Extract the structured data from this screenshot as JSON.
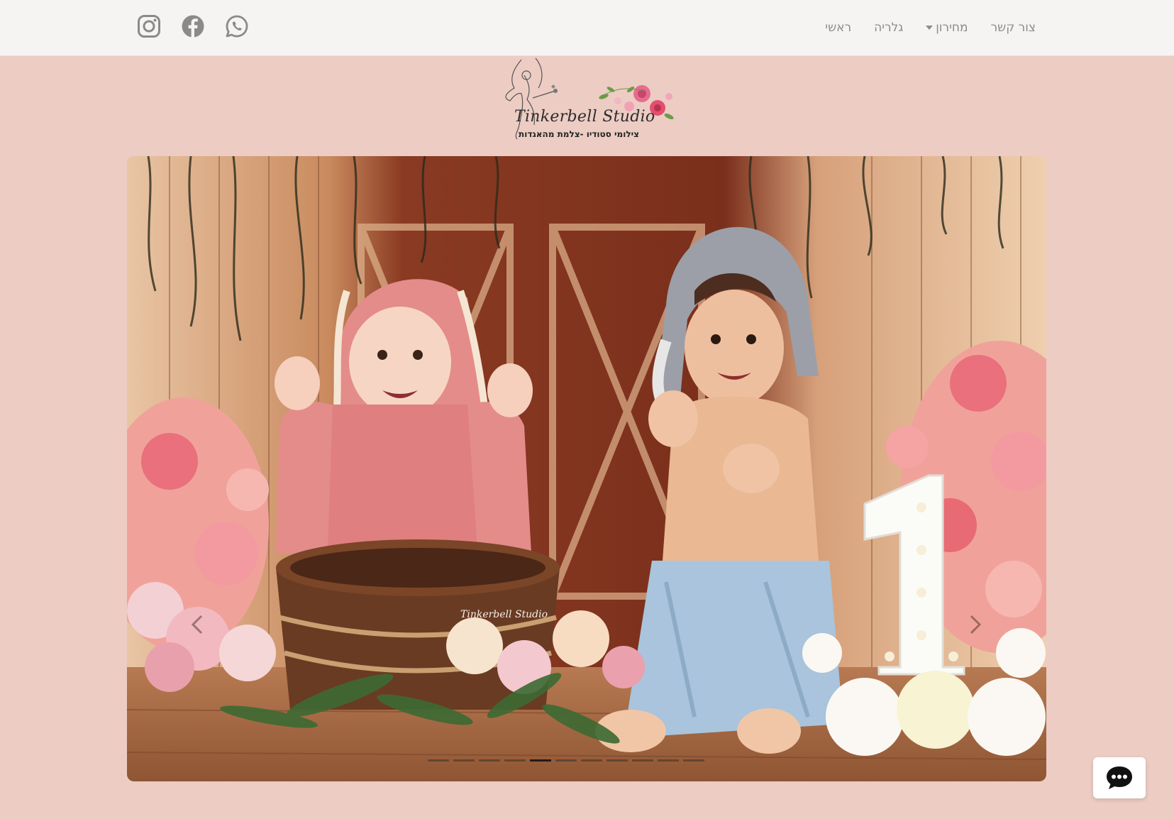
{
  "nav": {
    "items": [
      {
        "label": "ראשי"
      },
      {
        "label": "גלריה"
      },
      {
        "label": "מחירון",
        "has_dropdown": true
      },
      {
        "label": "צור קשר"
      }
    ]
  },
  "social": [
    {
      "icon": "instagram-icon"
    },
    {
      "icon": "facebook-icon"
    },
    {
      "icon": "whatsapp-icon"
    }
  ],
  "logo": {
    "title": "Tinkerbell Studio",
    "subtitle": "צילומי סטודיו -צלמת מהאגדות"
  },
  "hero": {
    "image_alt": "two toddlers in bunny hats with flowers and a light-up number 1",
    "slides_count": 11,
    "active_slide": 4
  },
  "colors": {
    "page_background": "#ecccc3",
    "nav_background": "#f5f4f2",
    "nav_text": "#8c8c8c",
    "icon_gray": "#8a8a8a"
  },
  "chat": {
    "icon": "chat-bubble-icon"
  }
}
